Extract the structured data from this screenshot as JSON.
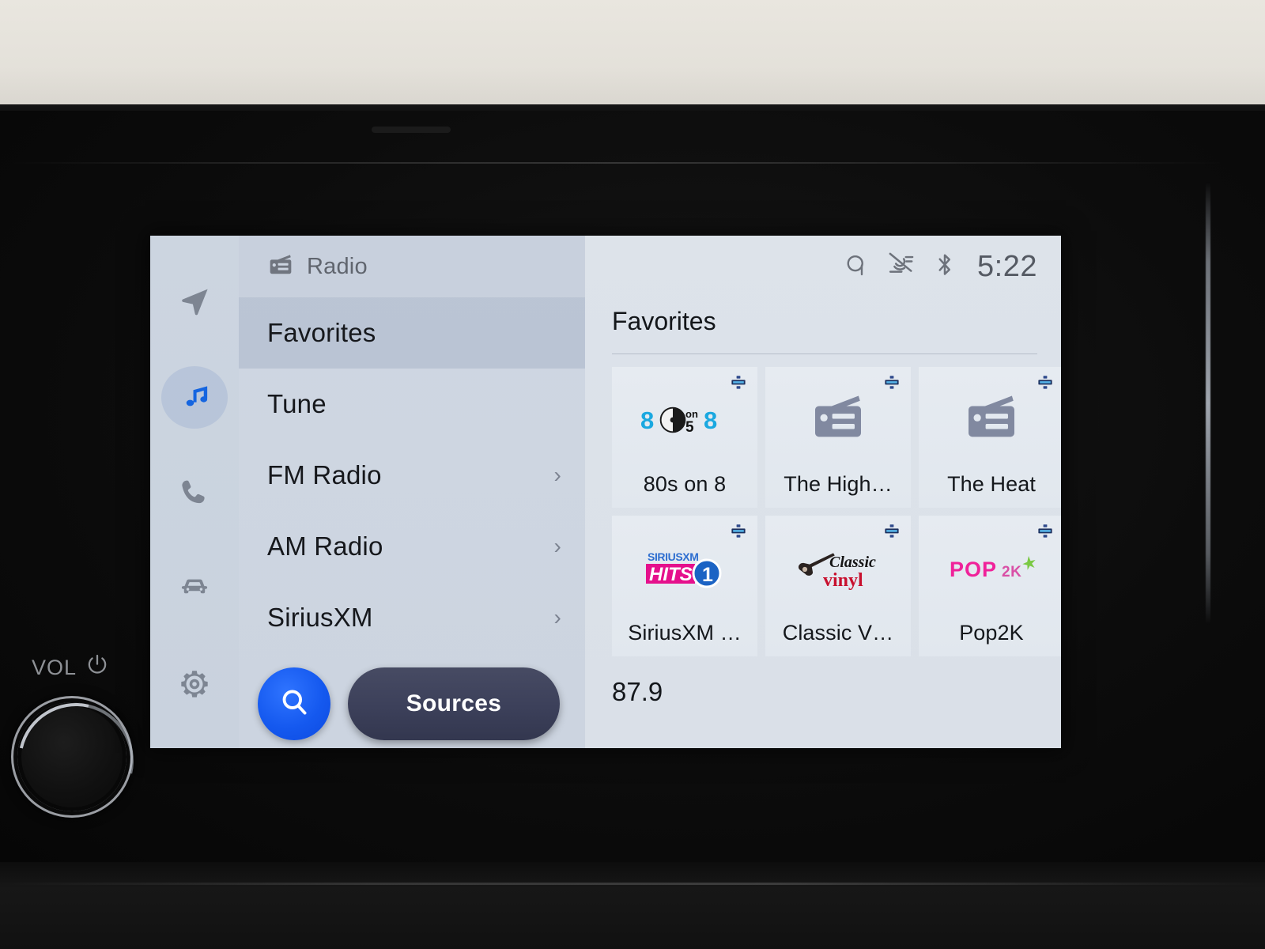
{
  "device": {
    "vol_label": "VOL",
    "power_icon": "power-icon",
    "knob": "volume-knob"
  },
  "rail": {
    "items": [
      {
        "name": "navigation",
        "icon": "navigation-arrow-icon",
        "active": false
      },
      {
        "name": "media",
        "icon": "music-note-icon",
        "active": true
      },
      {
        "name": "phone",
        "icon": "phone-icon",
        "active": false
      },
      {
        "name": "vehicle",
        "icon": "car-icon",
        "active": false
      },
      {
        "name": "settings",
        "icon": "gear-icon",
        "active": false
      }
    ]
  },
  "source_panel": {
    "header": {
      "icon": "radio-icon",
      "title": "Radio"
    },
    "items": [
      {
        "label": "Favorites",
        "selected": true,
        "chevron": ""
      },
      {
        "label": "Tune",
        "selected": false,
        "chevron": ""
      },
      {
        "label": "FM Radio",
        "selected": false,
        "chevron": "›"
      },
      {
        "label": "AM Radio",
        "selected": false,
        "chevron": "›"
      },
      {
        "label": "SiriusXM",
        "selected": false,
        "chevron": "›"
      }
    ],
    "search_icon": "search-icon",
    "sources_label": "Sources"
  },
  "statusbar": {
    "icons": [
      "wireless-charging-qi-icon",
      "microphone-muted-icon",
      "bluetooth-icon"
    ],
    "clock": "5:22"
  },
  "favorites": {
    "title": "Favorites",
    "tiles": [
      {
        "name": "80s on 8",
        "art": "80s-on-8-logo",
        "badge": "siriusxm-satellite-badge"
      },
      {
        "name": "The High…",
        "art": "radio-icon",
        "badge": "siriusxm-satellite-badge"
      },
      {
        "name": "The Heat",
        "art": "radio-icon",
        "badge": "siriusxm-satellite-badge"
      },
      {
        "name": "SiriusXM …",
        "art": "siriusxm-hits-1-logo",
        "badge": "siriusxm-satellite-badge"
      },
      {
        "name": "Classic V…",
        "art": "classic-vinyl-logo",
        "badge": "siriusxm-satellite-badge"
      },
      {
        "name": "Pop2K",
        "art": "pop2k-logo",
        "badge": "siriusxm-satellite-badge"
      }
    ]
  },
  "now_playing": {
    "frequency": "87.9"
  },
  "logos": {
    "eighties": {
      "left": "8",
      "center_top": "on",
      "center_bottom": "5",
      "right": "8"
    },
    "hits1": {
      "brand": "SIRIUSXM",
      "word": "HITS",
      "number": "1"
    },
    "classic_vinyl": {
      "top": "Classic",
      "bottom": "vinyl"
    },
    "pop2k": {
      "main": "POP",
      "sub": "2K"
    }
  },
  "colors": {
    "accent_blue": "#1559ef",
    "sources_navy": "#3c405a",
    "screen_bg": "#dae0e8",
    "rail_bg": "#ccd5e0",
    "list_bg": "#ccd4e0",
    "selected_row": "#a8b4c8",
    "tile_bg": "#e3e9f0",
    "text_primary": "#14171b",
    "text_muted": "#6d727b",
    "logo_cyan": "#19a8e0",
    "logo_magenta": "#e5108c",
    "logo_red": "#c8102e",
    "logo_green": "#7ac943"
  }
}
